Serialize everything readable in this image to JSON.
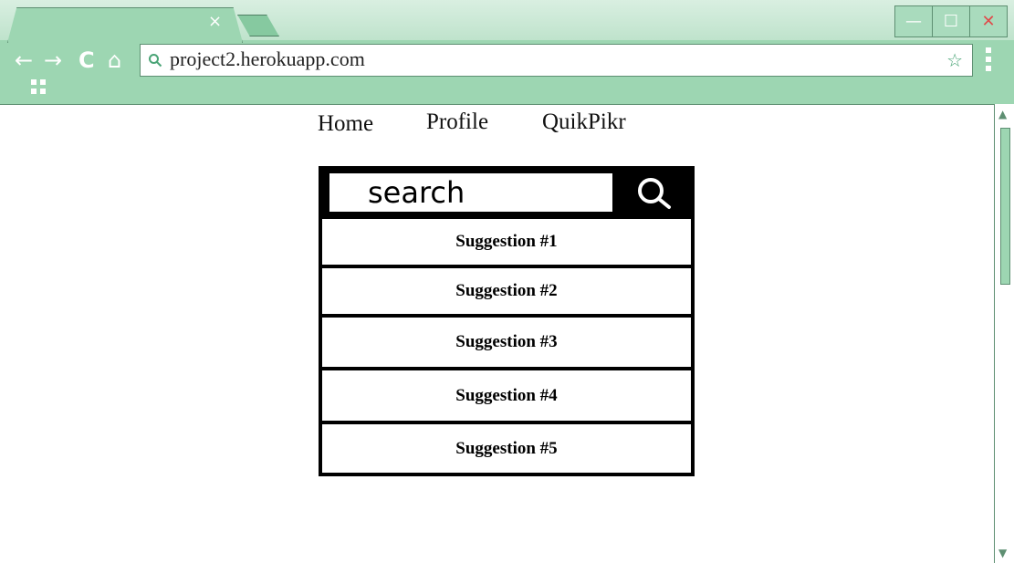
{
  "browser": {
    "tab_close": "×",
    "address": "project2.herokuapp.com",
    "window_buttons": {
      "minimize": "—",
      "maximize": "☐",
      "close": "✕"
    },
    "nav_buttons": {
      "back": "←",
      "forward": "→",
      "reload": "C",
      "home": "⌂"
    },
    "bookmark_star": "☆",
    "scroll_up": "▲",
    "scroll_down": "▼"
  },
  "nav": {
    "home": "Home",
    "profile": "Profile",
    "quikpikr": "QuikPikr"
  },
  "search": {
    "placeholder": "search"
  },
  "suggestions": [
    "Suggestion #1",
    "Suggestion #2",
    "Suggestion #3",
    "Suggestion #4",
    "Suggestion #5"
  ],
  "colors": {
    "chrome": "#9dd6b2",
    "accent": "#4aa476",
    "border": "#5e8f72"
  }
}
